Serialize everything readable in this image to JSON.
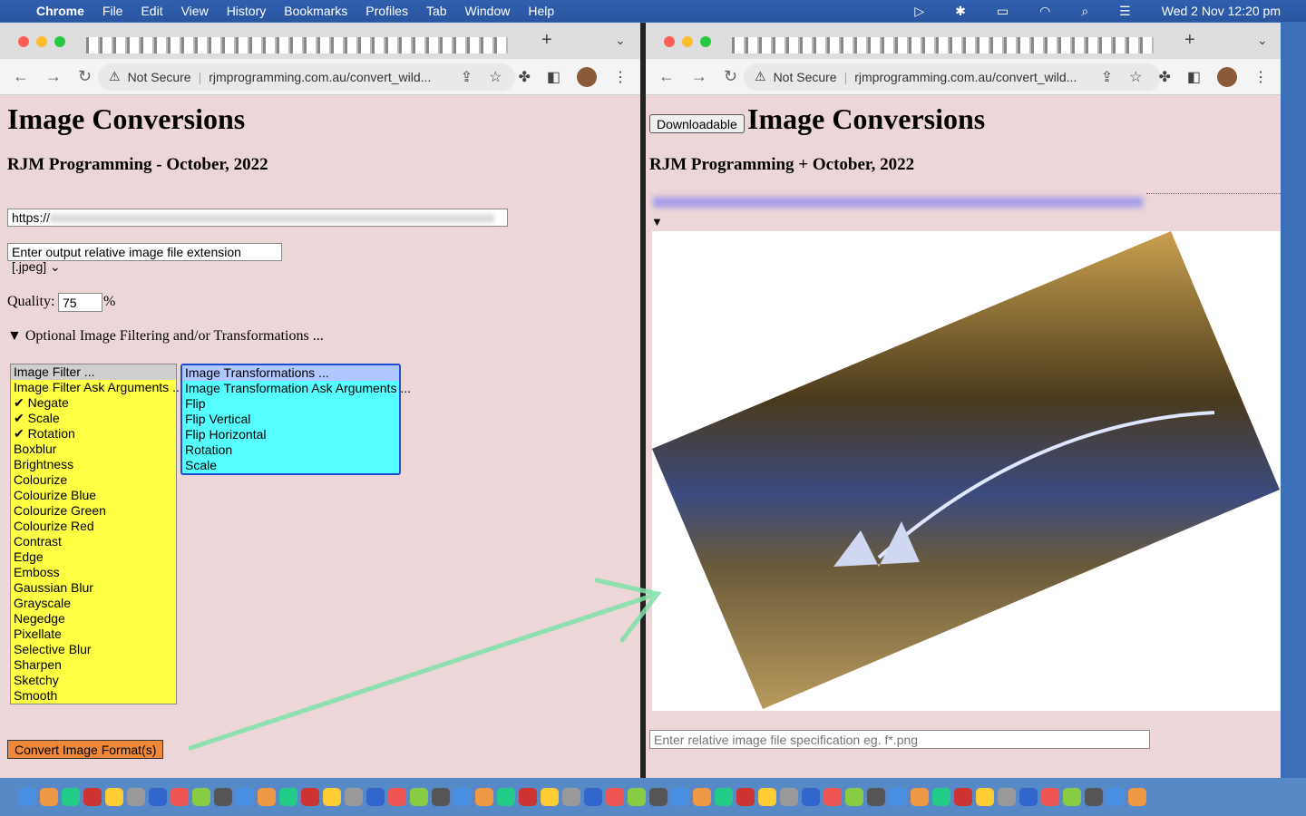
{
  "menubar": {
    "app": "Chrome",
    "items": [
      "File",
      "Edit",
      "View",
      "History",
      "Bookmarks",
      "Profiles",
      "Tab",
      "Window",
      "Help"
    ],
    "clock": "Wed 2 Nov  12:20 pm"
  },
  "browser": {
    "security": "Not Secure",
    "url": "rjmprogramming.com.au/convert_wild..."
  },
  "left": {
    "title": "Image Conversions",
    "subtitle": "RJM Programming - October, 2022",
    "url_value": "https://",
    "extension_select": "Enter output relative image file extension [.jpeg]",
    "quality_label": "Quality:",
    "quality_value": "75",
    "quality_unit": "%",
    "details_summary": "Optional Image Filtering and/or Transformations ...",
    "filters": [
      "Image Filter ...",
      "Image Filter Ask Arguments ...",
      "✔ Negate",
      "✔ Scale",
      "✔ Rotation",
      "Boxblur",
      "Brightness",
      "Colourize",
      "Colourize Blue",
      "Colourize Green",
      "Colourize Red",
      "Contrast",
      "Edge",
      "Emboss",
      "Gaussian Blur",
      "Grayscale",
      "Negedge",
      "Pixellate",
      "Selective Blur",
      "Sharpen",
      "Sketchy",
      "Smooth"
    ],
    "transformations": [
      "Image Transformations ...",
      "Image Transformation Ask Arguments ...",
      "Flip",
      "Flip Vertical",
      "Flip Horizontal",
      "Rotation",
      "Scale"
    ],
    "convert_button": "Convert Image Format(s)"
  },
  "right": {
    "download_button": "Downloadable",
    "title": "Image Conversions",
    "subtitle": "RJM Programming + October, 2022",
    "spec_placeholder": "Enter relative image file specification eg. f*.png"
  },
  "colors": {
    "filter_bg": "#ffff44",
    "transform_bg": "#55ffff",
    "page_bg": "#ecd6d8",
    "button_bg": "#f0883a",
    "arrow": "#7fe0a8"
  }
}
